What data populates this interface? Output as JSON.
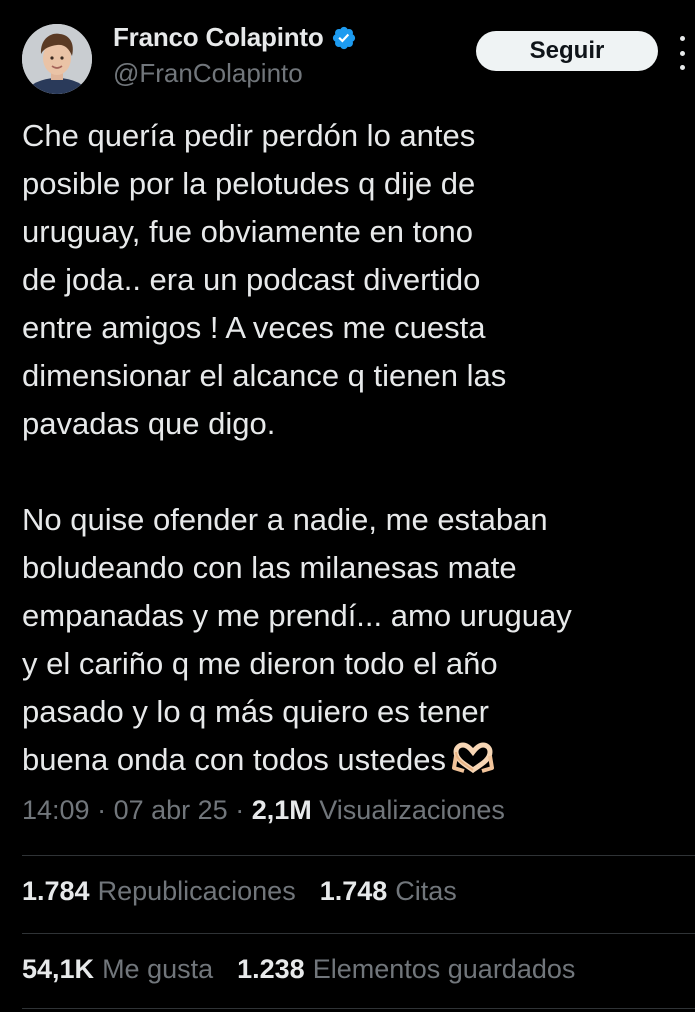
{
  "author": {
    "display_name": "Franco Colapinto",
    "handle": "@FranColapinto",
    "verified": true,
    "avatar_icon": "profile-photo"
  },
  "actions": {
    "follow_label": "Seguir",
    "more_icon": "more-vertical-icon"
  },
  "tweet": {
    "paragraph_1": [
      "Che quería pedir perdón lo antes",
      "posible por la pelotudes q dije de",
      "uruguay, fue obviamente en tono",
      "de joda.. era un podcast divertido",
      "entre amigos ! A veces me cuesta",
      "dimensionar el alcance q tienen las",
      "pavadas que digo."
    ],
    "paragraph_2": [
      "No quise ofender a nadie, me estaban",
      "boludeando con las milanesas mate",
      "empanadas y me prendí... amo uruguay",
      "y el cariño q me dieron todo el año",
      "pasado y lo q más quiero es tener",
      "buena onda con todos ustedes"
    ],
    "emoji": "heart-hands-icon"
  },
  "meta": {
    "time": "14:09",
    "separator": "·",
    "date": "07 abr 25",
    "views_count": "2,1M",
    "views_label": "Visualizaciones"
  },
  "stats": {
    "reposts_count": "1.784",
    "reposts_label": "Republicaciones",
    "quotes_count": "1.748",
    "quotes_label": "Citas",
    "likes_count": "54,1K",
    "likes_label": "Me gusta",
    "bookmarks_count": "1.238",
    "bookmarks_label": "Elementos guardados"
  },
  "colors": {
    "background": "#000000",
    "text_primary": "#e7e9ea",
    "text_secondary": "#71767b",
    "verified_blue": "#1d9bf0",
    "divider": "#2f3336",
    "button_bg": "#eff3f4"
  }
}
